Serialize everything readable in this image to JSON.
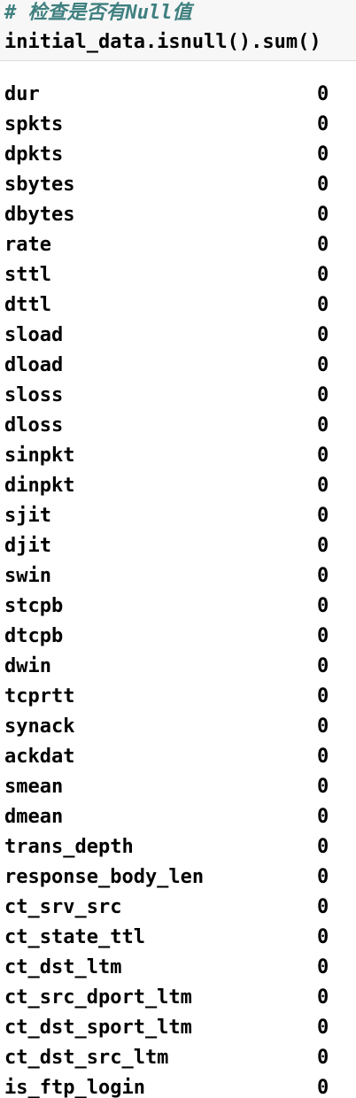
{
  "cell": {
    "comment": "# 检查是否有Null值",
    "code": "initial_data.isnull().sum()"
  },
  "output": {
    "rows": [
      {
        "name": "dur",
        "value": "0"
      },
      {
        "name": "spkts",
        "value": "0"
      },
      {
        "name": "dpkts",
        "value": "0"
      },
      {
        "name": "sbytes",
        "value": "0"
      },
      {
        "name": "dbytes",
        "value": "0"
      },
      {
        "name": "rate",
        "value": "0"
      },
      {
        "name": "sttl",
        "value": "0"
      },
      {
        "name": "dttl",
        "value": "0"
      },
      {
        "name": "sload",
        "value": "0"
      },
      {
        "name": "dload",
        "value": "0"
      },
      {
        "name": "sloss",
        "value": "0"
      },
      {
        "name": "dloss",
        "value": "0"
      },
      {
        "name": "sinpkt",
        "value": "0"
      },
      {
        "name": "dinpkt",
        "value": "0"
      },
      {
        "name": "sjit",
        "value": "0"
      },
      {
        "name": "djit",
        "value": "0"
      },
      {
        "name": "swin",
        "value": "0"
      },
      {
        "name": "stcpb",
        "value": "0"
      },
      {
        "name": "dtcpb",
        "value": "0"
      },
      {
        "name": "dwin",
        "value": "0"
      },
      {
        "name": "tcprtt",
        "value": "0"
      },
      {
        "name": "synack",
        "value": "0"
      },
      {
        "name": "ackdat",
        "value": "0"
      },
      {
        "name": "smean",
        "value": "0"
      },
      {
        "name": "dmean",
        "value": "0"
      },
      {
        "name": "trans_depth",
        "value": "0"
      },
      {
        "name": "response_body_len",
        "value": "0"
      },
      {
        "name": "ct_srv_src",
        "value": "0"
      },
      {
        "name": "ct_state_ttl",
        "value": "0"
      },
      {
        "name": "ct_dst_ltm",
        "value": "0"
      },
      {
        "name": "ct_src_dport_ltm",
        "value": "0"
      },
      {
        "name": "ct_dst_sport_ltm",
        "value": "0"
      },
      {
        "name": "ct_dst_src_ltm",
        "value": "0"
      },
      {
        "name": "is_ftp_login",
        "value": "0"
      }
    ]
  }
}
